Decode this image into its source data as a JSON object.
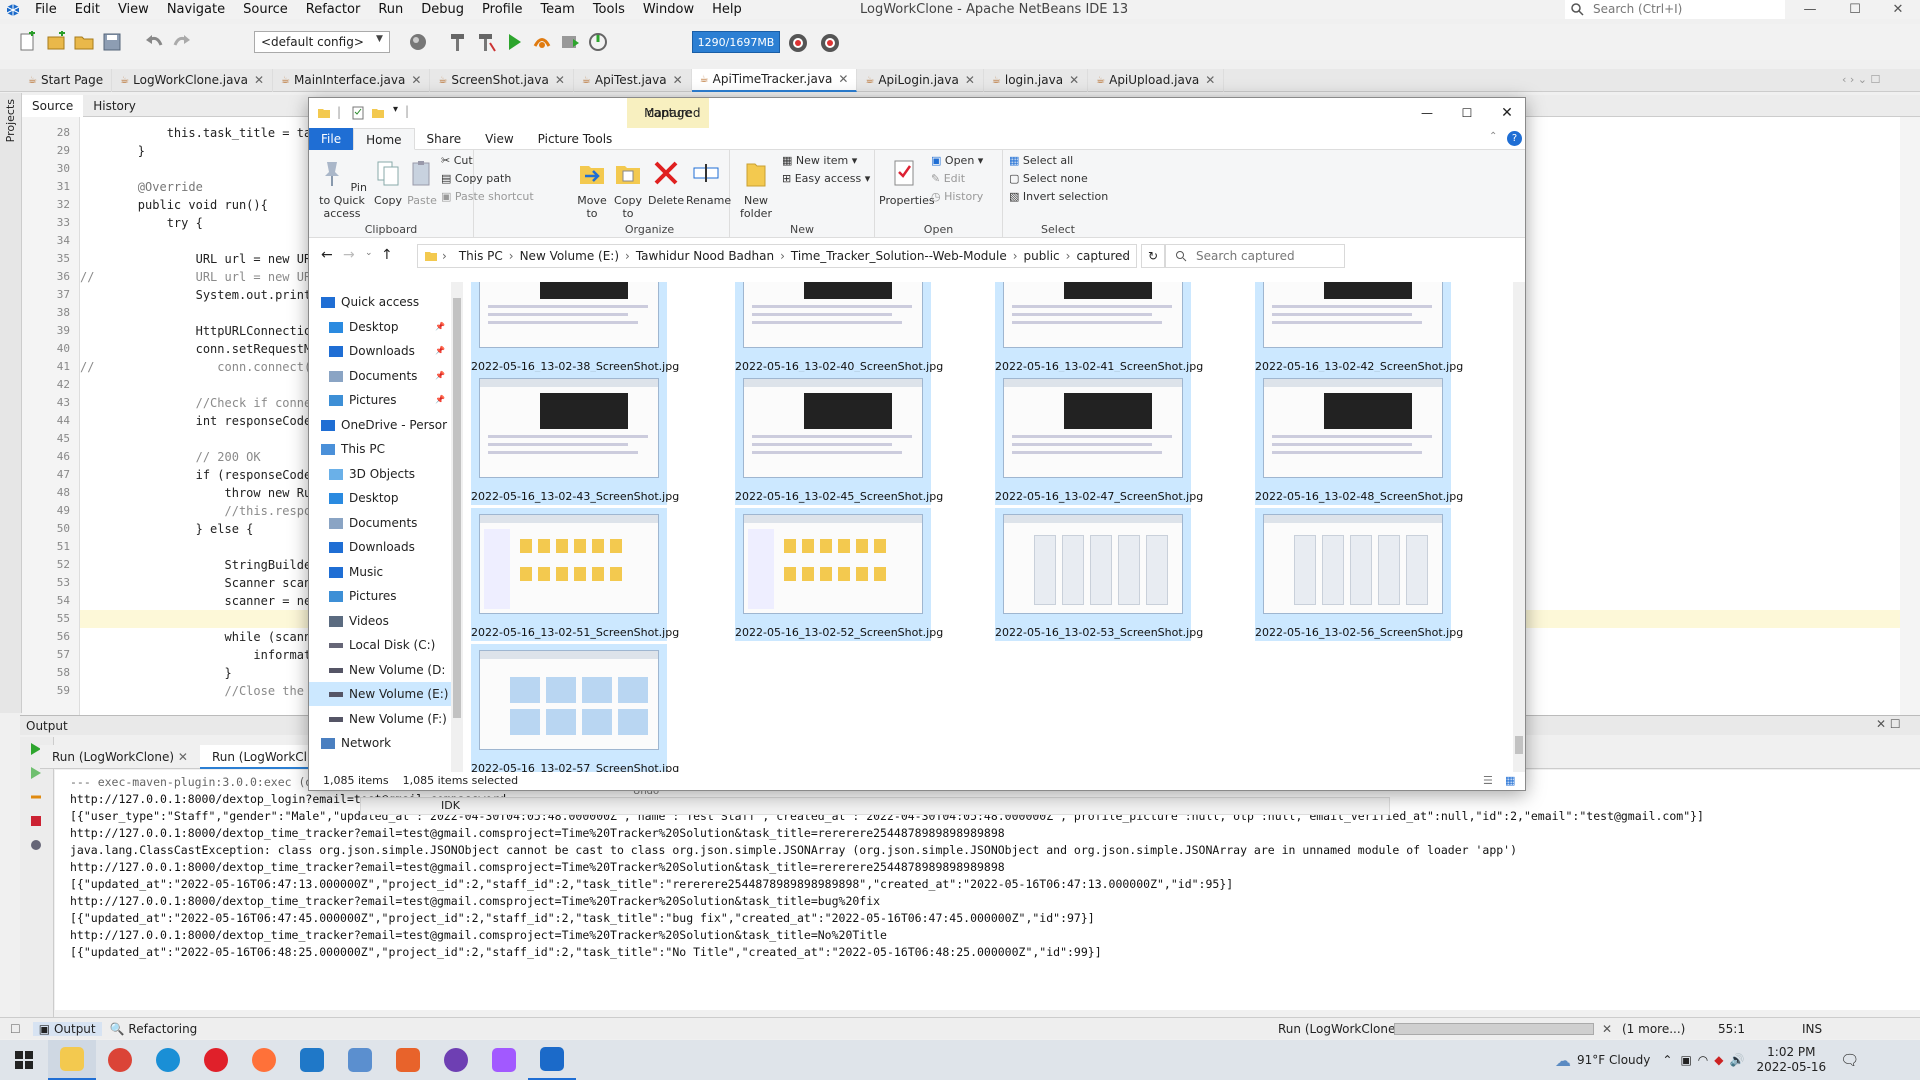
{
  "app": {
    "title": "LogWorkClone - Apache NetBeans IDE 13",
    "menu": [
      "File",
      "Edit",
      "View",
      "Navigate",
      "Source",
      "Refactor",
      "Run",
      "Debug",
      "Profile",
      "Team",
      "Tools",
      "Window",
      "Help"
    ],
    "search_placeholder": "Search (Ctrl+I)",
    "config": "<default config>",
    "memory": "1290/1697MB"
  },
  "editor_tabs": [
    {
      "label": "Start Page"
    },
    {
      "label": "LogWorkClone.java"
    },
    {
      "label": "MainInterface.java"
    },
    {
      "label": "ScreenShot.java"
    },
    {
      "label": "ApiTest.java"
    },
    {
      "label": "ApiTimeTracker.java",
      "active": true
    },
    {
      "label": "ApiLogin.java"
    },
    {
      "label": "login.java"
    },
    {
      "label": "ApiUpload.java"
    }
  ],
  "editor": {
    "source_tab": "Source",
    "history_tab": "History",
    "projects_label": "Projects",
    "lines": [
      {
        "n": "28",
        "t": "            this.task_title = tas"
      },
      {
        "n": "29",
        "t": "        }"
      },
      {
        "n": "30",
        "t": ""
      },
      {
        "n": "31",
        "t": "        @Override"
      },
      {
        "n": "32",
        "t": "        public void run(){"
      },
      {
        "n": "33",
        "t": "            try {"
      },
      {
        "n": "34",
        "t": ""
      },
      {
        "n": "35",
        "t": "                URL url = new URI"
      },
      {
        "n": "36",
        "t": "//              URL url = new URI"
      },
      {
        "n": "37",
        "t": "                System.out.printl"
      },
      {
        "n": "38",
        "t": ""
      },
      {
        "n": "39",
        "t": "                HttpURLConnection"
      },
      {
        "n": "40",
        "t": "                conn.setRequestMe"
      },
      {
        "n": "41",
        "t": "//                 conn.connect();"
      },
      {
        "n": "42",
        "t": ""
      },
      {
        "n": "43",
        "t": "                //Check if connec"
      },
      {
        "n": "44",
        "t": "                int responseCode"
      },
      {
        "n": "45",
        "t": ""
      },
      {
        "n": "46",
        "t": "                // 200 OK"
      },
      {
        "n": "47",
        "t": "                if (responseCode"
      },
      {
        "n": "48",
        "t": "                    throw new Run"
      },
      {
        "n": "49",
        "t": "                    //this.respon"
      },
      {
        "n": "50",
        "t": "                } else {"
      },
      {
        "n": "51",
        "t": ""
      },
      {
        "n": "52",
        "t": "                    StringBuilder"
      },
      {
        "n": "53",
        "t": "                    Scanner scann"
      },
      {
        "n": "54",
        "t": "                    scanner = new"
      },
      {
        "n": "55",
        "t": ""
      },
      {
        "n": "56",
        "t": "                    while (scanne"
      },
      {
        "n": "57",
        "t": "                        informati"
      },
      {
        "n": "58",
        "t": "                    }"
      },
      {
        "n": "59",
        "t": "                    //Close the s"
      }
    ]
  },
  "output": {
    "header": "Output",
    "tabs": [
      "Run (LogWorkClone)",
      "Run (LogWorkCl"
    ],
    "lines": [
      "--- exec-maven-plugin:3.0.0:exec (default-cli) @ Lo",
      "http://127.0.0.1:8000/dextop_login?email=test@gmail.compassword=",
      "[{\"user_type\":\"Staff\",\"gender\":\"Male\",\"updated_at\":\"2022-04-30T04:05:48.000000Z\",\"name\":\"Test Staff\",\"created_at\":\"2022-04-30T04:05:48.000000Z\",\"profile_picture\":null,\"otp\":null,\"email_verified_at\":null,\"id\":2,\"email\":\"test@gmail.com\"}]",
      "http://127.0.0.1:8000/dextop_time_tracker?email=test@gmail.comsproject=Time%20Tracker%20Solution&task_title=rererere2544878989898989898",
      "java.lang.ClassCastException: class org.json.simple.JSONObject cannot be cast to class org.json.simple.JSONArray (org.json.simple.JSONObject and org.json.simple.JSONArray are in unnamed module of loader 'app')",
      "http://127.0.0.1:8000/dextop_time_tracker?email=test@gmail.comsproject=Time%20Tracker%20Solution&task_title=rererere2544878989898989898",
      "[{\"updated_at\":\"2022-05-16T06:47:13.000000Z\",\"project_id\":2,\"staff_id\":2,\"task_title\":\"rererere2544878989898989898\",\"created_at\":\"2022-05-16T06:47:13.000000Z\",\"id\":95}]",
      "http://127.0.0.1:8000/dextop_time_tracker?email=test@gmail.comsproject=Time%20Tracker%20Solution&task_title=bug%20fix",
      "[{\"updated_at\":\"2022-05-16T06:47:45.000000Z\",\"project_id\":2,\"staff_id\":2,\"task_title\":\"bug fix\",\"created_at\":\"2022-05-16T06:47:45.000000Z\",\"id\":97}]",
      "http://127.0.0.1:8000/dextop_time_tracker?email=test@gmail.comsproject=Time%20Tracker%20Solution&task_title=No%20Title",
      "[{\"updated_at\":\"2022-05-16T06:48:25.000000Z\",\"project_id\":2,\"staff_id\":2,\"task_title\":\"No Title\",\"created_at\":\"2022-05-16T06:48:25.000000Z\",\"id\":99}]"
    ],
    "idk": "IDK",
    "undo": "Undo"
  },
  "nb_status": {
    "output_tab": "Output",
    "refactoring_tab": "Refactoring",
    "run_label": "Run (LogWorkClone)",
    "more": "(1 more...)",
    "position": "55:1",
    "mode": "INS"
  },
  "explorer": {
    "manage": "Manage",
    "caption": "captured",
    "ribbon_tabs": [
      "File",
      "Home",
      "Share",
      "View",
      "Picture Tools"
    ],
    "clipboard": {
      "pin": "Pin to Quick access",
      "copy": "Copy",
      "paste": "Paste",
      "cut": "Cut",
      "copy_path": "Copy path",
      "paste_shortcut": "Paste shortcut",
      "label": "Clipboard"
    },
    "organize": {
      "move_to": "Move to",
      "copy_to": "Copy to",
      "delete": "Delete",
      "rename": "Rename",
      "label": "Organize"
    },
    "new": {
      "new_folder": "New folder",
      "new_item": "New item",
      "easy_access": "Easy access",
      "label": "New"
    },
    "open": {
      "properties": "Properties",
      "open": "Open",
      "edit": "Edit",
      "history": "History",
      "label": "Open"
    },
    "select": {
      "all": "Select all",
      "none": "Select none",
      "invert": "Invert selection",
      "label": "Select"
    },
    "path": [
      "This PC",
      "New Volume (E:)",
      "Tawhidur Nood Badhan",
      "Time_Tracker_Solution--Web-Module",
      "public",
      "captured"
    ],
    "search_placeholder": "Search captured",
    "nav": [
      {
        "label": "Quick access",
        "icon": "star"
      },
      {
        "label": "Desktop",
        "icon": "folder-blue",
        "pin": true
      },
      {
        "label": "Downloads",
        "icon": "download",
        "pin": true
      },
      {
        "label": "Documents",
        "icon": "documents",
        "pin": true
      },
      {
        "label": "Pictures",
        "icon": "pictures",
        "pin": true
      },
      {
        "label": "OneDrive - Persor",
        "icon": "cloud"
      },
      {
        "label": "This PC",
        "icon": "pc"
      },
      {
        "label": "3D Objects",
        "icon": "cube"
      },
      {
        "label": "Desktop",
        "icon": "folder-blue"
      },
      {
        "label": "Documents",
        "icon": "documents"
      },
      {
        "label": "Downloads",
        "icon": "download"
      },
      {
        "label": "Music",
        "icon": "music"
      },
      {
        "label": "Pictures",
        "icon": "pictures"
      },
      {
        "label": "Videos",
        "icon": "videos"
      },
      {
        "label": "Local Disk (C:)",
        "icon": "disk"
      },
      {
        "label": "New Volume (D:",
        "icon": "drive"
      },
      {
        "label": "New Volume (E:)",
        "icon": "drive",
        "selected": true
      },
      {
        "label": "New Volume (F:)",
        "icon": "drive"
      },
      {
        "label": "Network",
        "icon": "network"
      }
    ],
    "files": [
      "2022-05-16_13-02-38_ScreenShot.jpg",
      "2022-05-16_13-02-40_ScreenShot.jpg",
      "2022-05-16_13-02-41_ScreenShot.jpg",
      "2022-05-16_13-02-42_ScreenShot.jpg",
      "2022-05-16_13-02-43_ScreenShot.jpg",
      "2022-05-16_13-02-45_ScreenShot.jpg",
      "2022-05-16_13-02-47_ScreenShot.jpg",
      "2022-05-16_13-02-48_ScreenShot.jpg",
      "2022-05-16_13-02-51_ScreenShot.jpg",
      "2022-05-16_13-02-52_ScreenShot.jpg",
      "2022-05-16_13-02-53_ScreenShot.jpg",
      "2022-05-16_13-02-56_ScreenShot.jpg",
      "2022-05-16_13-02-57_ScreenShot.jpg"
    ],
    "status_items": "1,085 items",
    "status_selected": "1,085 items selected"
  },
  "taskbar": {
    "weather": "91°F Cloudy",
    "time": "1:02 PM",
    "date": "2022-05-16",
    "apps": [
      "file-explorer",
      "chrome",
      "edge",
      "opera",
      "firefox",
      "vscode",
      "app-hex",
      "app-postman",
      "app-github",
      "app-figma",
      "netbeans"
    ]
  },
  "colors": {
    "accent": "#1f6ed4",
    "selection": "#cce8ff",
    "manage_tab": "#f8f0c0",
    "memory": "#2c7fd3"
  }
}
